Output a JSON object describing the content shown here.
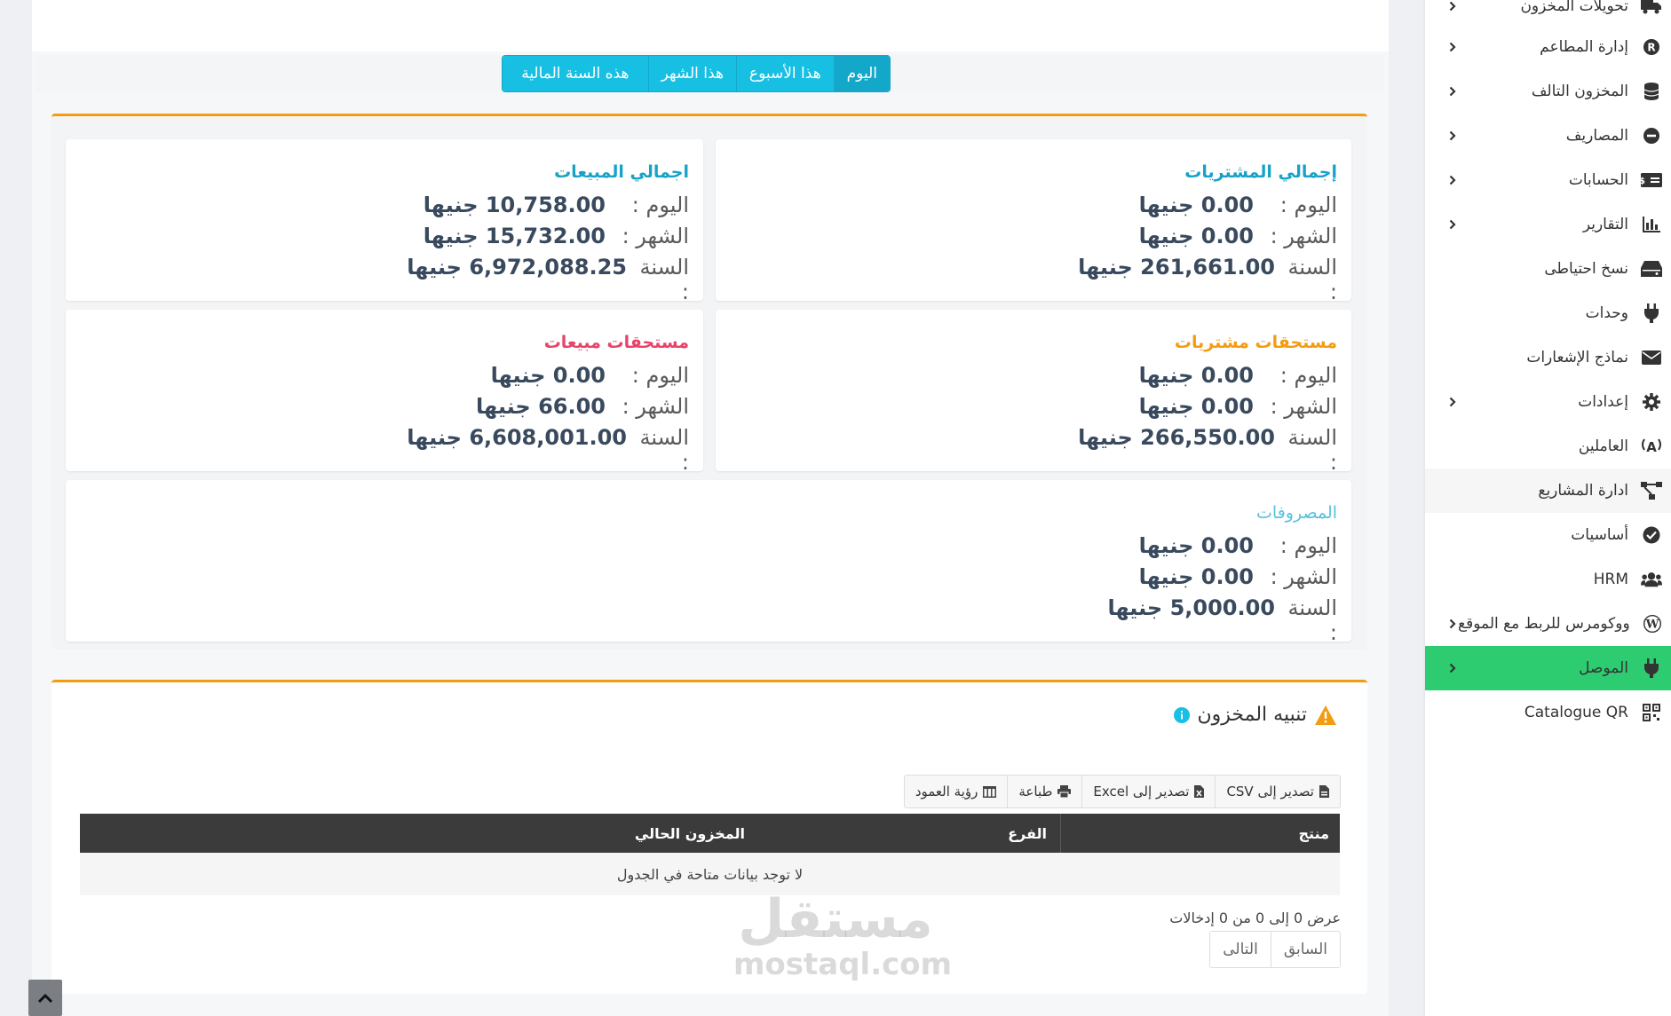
{
  "sidebar": {
    "items": [
      {
        "label": "تحويلات المخزون",
        "icon": "truck-icon",
        "chevron": true
      },
      {
        "label": "إدارة المطاعم",
        "icon": "registered-icon",
        "chevron": true
      },
      {
        "label": "المخزون التالف",
        "icon": "database-icon",
        "chevron": true
      },
      {
        "label": "المصاريف",
        "icon": "minus-circle-icon",
        "chevron": true
      },
      {
        "label": "الحسابات",
        "icon": "money-check-icon",
        "chevron": true
      },
      {
        "label": "التقارير",
        "icon": "bar-chart-icon",
        "chevron": true
      },
      {
        "label": "نسخ احتياطى",
        "icon": "hdd-icon",
        "chevron": false
      },
      {
        "label": "وحدات",
        "icon": "plug-icon",
        "chevron": false
      },
      {
        "label": "نماذج الإشعارات",
        "icon": "envelope-icon",
        "chevron": false
      },
      {
        "label": "إعدادات",
        "icon": "gear-icon",
        "chevron": true
      },
      {
        "label": "العاملين",
        "icon": "broadcast-icon",
        "chevron": false
      },
      {
        "label": "ادارة المشاريع",
        "icon": "project-diagram-icon",
        "chevron": false
      },
      {
        "label": "أساسيات",
        "icon": "check-circle-icon",
        "chevron": false
      },
      {
        "label": "HRM",
        "icon": "users-icon",
        "chevron": false
      },
      {
        "label": "ووكومرس للربط مع الموقع",
        "icon": "wordpress-icon",
        "chevron": true
      },
      {
        "label": "الموصل",
        "icon": "plug-icon",
        "chevron": true,
        "active": true
      },
      {
        "label": "Catalogue QR",
        "icon": "qrcode-icon",
        "chevron": false
      }
    ]
  },
  "period_tabs": [
    "اليوم",
    "هذا الأسبوع",
    "هذا الشهر",
    "هذه السنة المالية"
  ],
  "period_tabs_active": "اليوم",
  "cards": {
    "purchases_total": {
      "title": "إجمالي المشتريات",
      "color": "#17a2c8",
      "today_label": "اليوم :",
      "today": "0.00 جنيها",
      "month_label": "الشهر :",
      "month": "0.00 جنيها",
      "year_label": "السنة :",
      "year": "261,661.00 جنيها"
    },
    "sales_total": {
      "title": "اجمالي المبيعات",
      "color": "#17a2c8",
      "today_label": "اليوم :",
      "today": "10,758.00 جنيها",
      "month_label": "الشهر :",
      "month": "15,732.00 جنيها",
      "year_label": "السنة :",
      "year": "6,972,088.25 جنيها"
    },
    "purchases_due": {
      "title": "مستحقات مشتريات",
      "color": "#f39c12",
      "today_label": "اليوم :",
      "today": "0.00 جنيها",
      "month_label": "الشهر :",
      "month": "0.00 جنيها",
      "year_label": "السنة :",
      "year": "266,550.00 جنيها"
    },
    "sales_due": {
      "title": "مستحقات مبيعات",
      "color": "#e8436a",
      "today_label": "اليوم :",
      "today": "0.00 جنيها",
      "month_label": "الشهر :",
      "month": "66.00 جنيها",
      "year_label": "السنة :",
      "year": "6,608,001.00 جنيها"
    },
    "expenses": {
      "title": "المصروفات",
      "color": "#5bc0de",
      "today_label": "اليوم :",
      "today": "0.00 جنيها",
      "month_label": "الشهر :",
      "month": "0.00 جنيها",
      "year_label": "السنة :",
      "year": "5,000.00 جنيها"
    }
  },
  "stock_alert": {
    "title": "تنبيه المخزون",
    "buttons": {
      "csv": "تصدير إلى CSV",
      "excel": "تصدير إلى Excel",
      "print": "طباعة",
      "columns": "رؤية العمود"
    },
    "columns": [
      "منتج",
      "الفرع",
      "المخزون الحالي"
    ],
    "empty_text": "لا توجد بيانات متاحة في الجدول",
    "info_text": "عرض 0 إلى 0 من 0 إدخالات",
    "pager": {
      "prev": "السابق",
      "next": "التالى"
    }
  },
  "watermark": {
    "arabic": "مستقل",
    "latin": "mostaql.com"
  },
  "colors": {
    "accent_cyan": "#17c0e3",
    "accent_green": "#2ecc71",
    "panel_border": "#f39c12"
  }
}
